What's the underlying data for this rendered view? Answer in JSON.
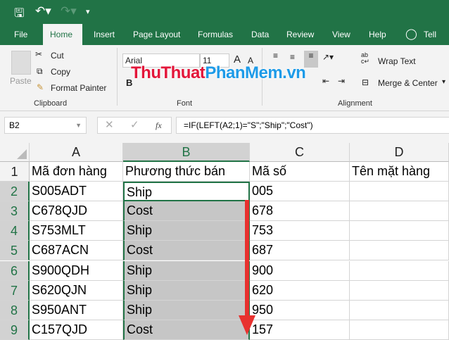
{
  "quick_access": {
    "save": "save-icon",
    "undo": "undo-icon",
    "redo": "redo-icon"
  },
  "tabs": [
    "File",
    "Home",
    "Insert",
    "Page Layout",
    "Formulas",
    "Data",
    "Review",
    "View",
    "Help",
    "Tell me"
  ],
  "ribbon": {
    "paste": "Paste",
    "cut": "Cut",
    "copy": "Copy",
    "format_painter": "Format Painter",
    "clipboard": "Clipboard",
    "font_name": "Arial",
    "font_size": "11",
    "bold": "B",
    "font": "Font",
    "wrap_text": "Wrap Text",
    "merge_center": "Merge & Center",
    "alignment": "Alignment"
  },
  "watermark": "ThuThuatPhanMem.vn",
  "formula_bar": {
    "name_box": "B2",
    "formula": "=IF(LEFT(A2;1)=\"S\";\"Ship\";\"Cost\")",
    "fx": "fx"
  },
  "columns": [
    "A",
    "B",
    "C",
    "D"
  ],
  "rows": [
    {
      "n": "1",
      "a": "Mã đơn hàng",
      "b": "Phương thức bán",
      "c": "Mã số",
      "d": "Tên mặt hàng"
    },
    {
      "n": "2",
      "a": "S005ADT",
      "b": "Ship",
      "c": "005",
      "d": ""
    },
    {
      "n": "3",
      "a": "C678QJD",
      "b": "Cost",
      "c": "678",
      "d": ""
    },
    {
      "n": "4",
      "a": "S753MLT",
      "b": "Ship",
      "c": "753",
      "d": ""
    },
    {
      "n": "5",
      "a": "C687ACN",
      "b": "Cost",
      "c": "687",
      "d": ""
    },
    {
      "n": "6",
      "a": "S900QDH",
      "b": "Ship",
      "c": "900",
      "d": ""
    },
    {
      "n": "7",
      "a": "S620QJN",
      "b": "Ship",
      "c": "620",
      "d": ""
    },
    {
      "n": "8",
      "a": "S950ANT",
      "b": "Ship",
      "c": "950",
      "d": ""
    },
    {
      "n": "9",
      "a": "C157QJD",
      "b": "Cost",
      "c": "157",
      "d": ""
    }
  ]
}
